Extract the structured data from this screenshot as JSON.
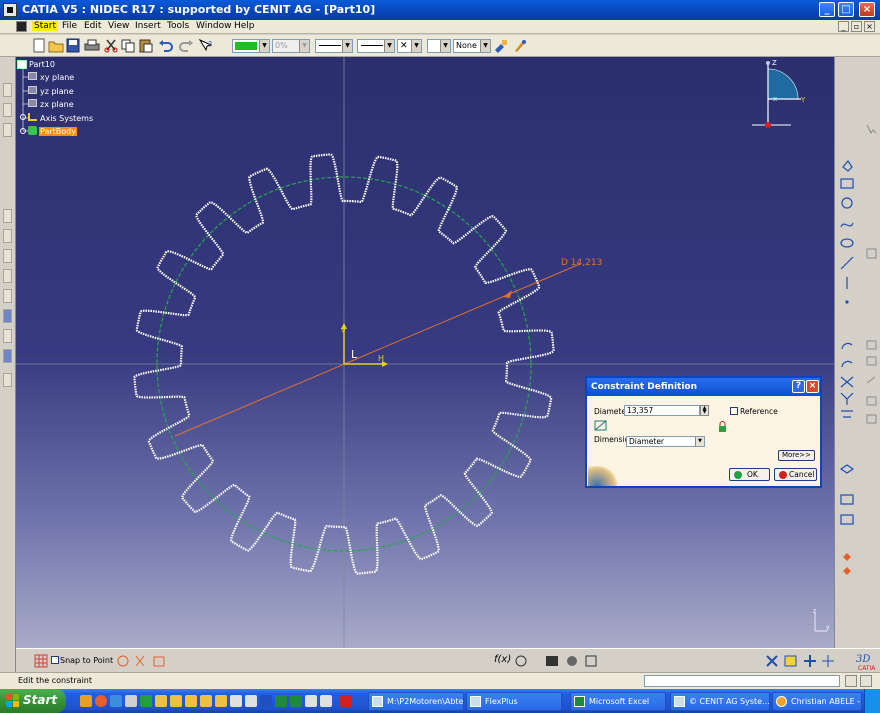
{
  "window": {
    "title": "CATIA V5 : NIDEC R17 : supported by CENIT AG - [Part10]",
    "min_glyph": "_",
    "max_glyph": "□",
    "close_glyph": "×"
  },
  "menu": [
    "Start",
    "File",
    "Edit",
    "View",
    "Insert",
    "Tools",
    "Window",
    "Help"
  ],
  "toolbar": {
    "percent_value": "0%",
    "none_value": "None",
    "color_value": "green"
  },
  "tree": {
    "root": "Part10",
    "items": [
      "xy plane",
      "yz plane",
      "zx plane",
      "Axis Systems",
      "PartBody"
    ]
  },
  "viewport": {
    "dimension_label": "D 14,213",
    "axis_h": "H",
    "axis_v": "V",
    "axis_l": "L",
    "compass_z": "Z",
    "compass_y": "Y",
    "compass_x": "x",
    "mini_axis_z": "z",
    "mini_axis_y": "y"
  },
  "dialog": {
    "title": "Constraint Definition",
    "diameter_label": "Diameter",
    "diameter_value": "13,357",
    "reference_label": "Reference",
    "dimension_label": "Dimension",
    "dimension_value": "Diameter",
    "more_label": "More>>",
    "ok_label": "OK",
    "cancel_label": "Cancel",
    "help_glyph": "?",
    "close_glyph": "×"
  },
  "bottombar": {
    "snap_label": "Snap to Point"
  },
  "status": {
    "text": "Edit the constraint"
  },
  "taskbar": {
    "start_label": "Start",
    "tasks": [
      "M:\\P2Motoren\\Abtei...",
      "FlexPlus",
      "Microsoft Excel",
      "© CENIT AG Syste...",
      "Christian ABELE - (A..."
    ]
  },
  "colors": {
    "accent": "#0a5bd8",
    "gear": "#ffffff",
    "pitch_circle": "#23a84a",
    "dimension_line": "#e07030",
    "tree_selected": "#ff8c00"
  }
}
